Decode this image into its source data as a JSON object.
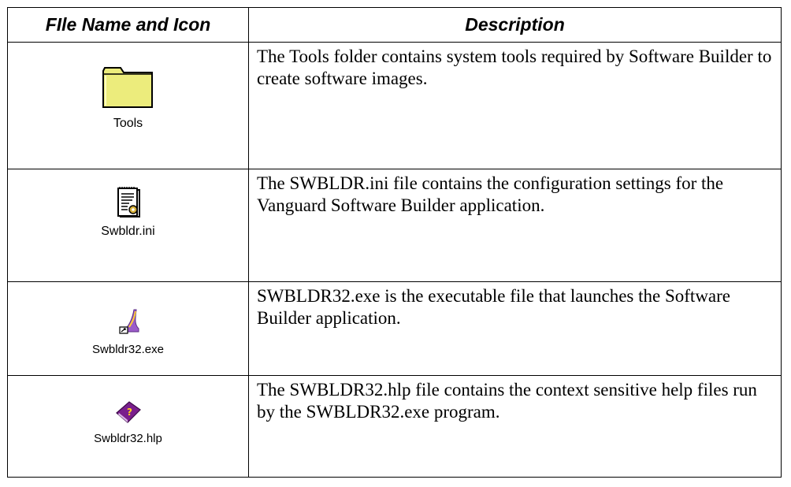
{
  "table": {
    "headers": {
      "file": "FIle Name and Icon",
      "description": "Description"
    },
    "rows": [
      {
        "icon": "folder-icon",
        "file_name": "Tools",
        "description": "The Tools folder contains system tools required by Software Builder to create software images."
      },
      {
        "icon": "ini-settings-file-icon",
        "file_name": "Swbldr.ini",
        "description": "The SWBLDR.ini file contains the configuration settings for the Vanguard Software Builder application."
      },
      {
        "icon": "exe-shortcut-icon",
        "file_name": "Swbldr32.exe",
        "description": "SWBLDR32.exe is the executable file that launches the Software Builder application."
      },
      {
        "icon": "help-book-icon",
        "file_name": "Swbldr32.hlp",
        "description": "The SWBLDR32.hlp file contains the context sensitive help files run by the SWBLDR32.exe program."
      }
    ]
  },
  "colors": {
    "folder_fill": "#ecec7c",
    "help_book": "#7a1e8c"
  }
}
